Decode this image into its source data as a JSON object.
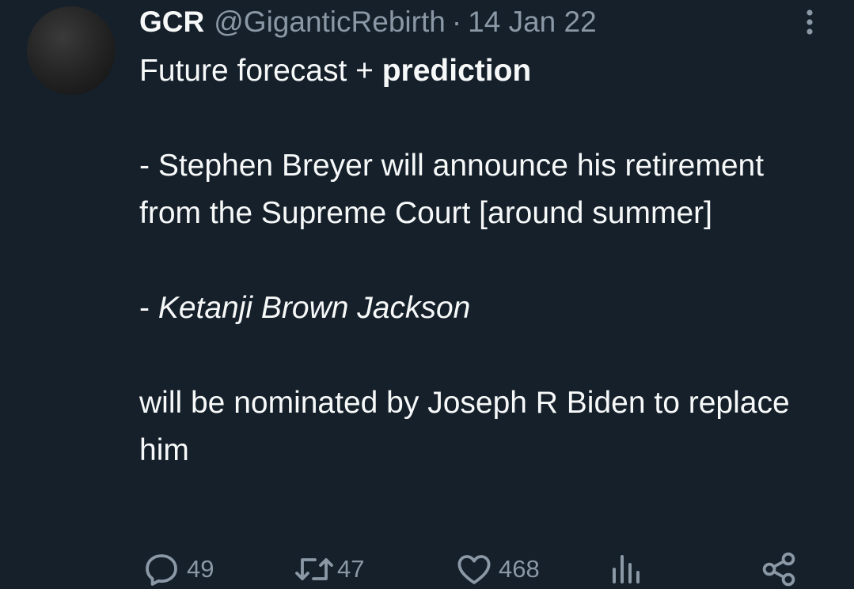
{
  "tweet": {
    "author_name": "GCR",
    "handle": "@GiganticRebirth",
    "separator": "·",
    "date": "14 Jan 22",
    "line1_normal": "Future forecast + ",
    "line1_bold": "prediction",
    "para2": "- Stephen Breyer will announce his retirement from the Supreme Court [around summer]",
    "para3_prefix": "- ",
    "para3_italic": "Ketanji Brown Jackson",
    "para4": "will be nominated by Joseph R Biden to replace him"
  },
  "actions": {
    "replies": "49",
    "retweets": "47",
    "likes": "468"
  },
  "icons": {
    "avatar": "avatar",
    "more": "more-vertical-icon",
    "reply": "reply-icon",
    "retweet": "retweet-icon",
    "like": "heart-icon",
    "views": "views-icon",
    "share": "share-icon"
  },
  "colors": {
    "background": "#15202b",
    "text": "#f7f9f9",
    "muted": "#8b98a5"
  }
}
